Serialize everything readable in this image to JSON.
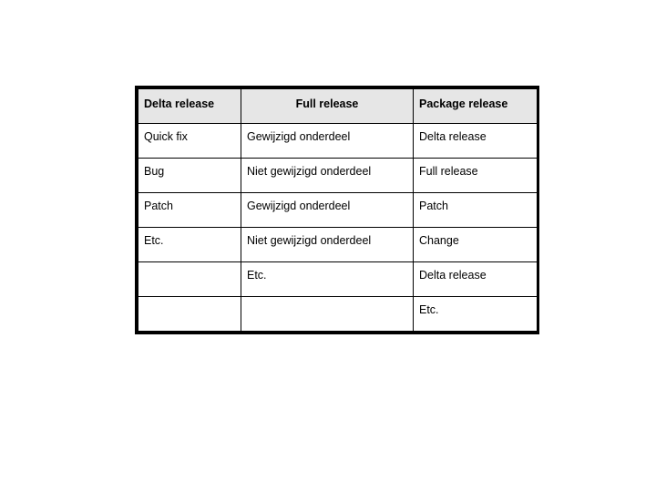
{
  "slide": {
    "background_color": "#FFFFFF"
  },
  "table": {
    "name": "release-comparison-table",
    "border_color": "#000000",
    "header_background": "#E6E6E6",
    "cell_background": "#FFFFFF",
    "text_color": "#000000",
    "columns": [
      {
        "key": "delta",
        "label": "Delta release",
        "align": "left"
      },
      {
        "key": "full",
        "label": "Full release",
        "align": "center"
      },
      {
        "key": "package",
        "label": "Package release",
        "align": "left"
      }
    ],
    "rows": [
      {
        "delta": "Quick fix",
        "full": "Gewijzigd onderdeel",
        "package": "Delta release"
      },
      {
        "delta": "Bug",
        "full": "Niet gewijzigd onderdeel",
        "package": "Full release"
      },
      {
        "delta": "Patch",
        "full": "Gewijzigd onderdeel",
        "package": "Patch"
      },
      {
        "delta": "Etc.",
        "full": "Niet gewijzigd onderdeel",
        "package": "Change"
      },
      {
        "delta": "",
        "full": "Etc.",
        "package": "Delta release"
      },
      {
        "delta": "",
        "full": "",
        "package": "Etc."
      }
    ]
  }
}
